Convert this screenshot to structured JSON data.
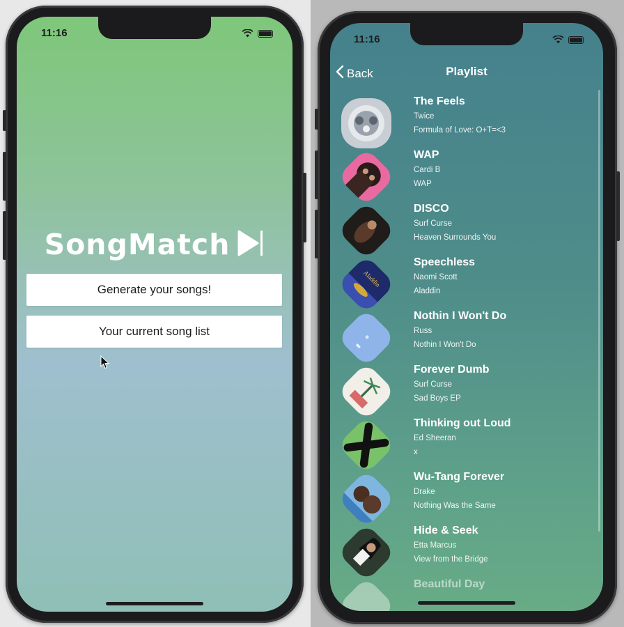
{
  "left_screen": {
    "status_time": "11:16",
    "app_logo_text": "SongMatch",
    "buttons": {
      "generate": "Generate your songs!",
      "song_list": "Your current song list"
    }
  },
  "right_screen": {
    "status_time": "11:16",
    "nav": {
      "back_label": "Back",
      "title": "Playlist"
    },
    "songs": [
      {
        "title": "The Feels",
        "artist": "Twice",
        "album": "Formula of Love: O+T=<3"
      },
      {
        "title": "WAP",
        "artist": "Cardi B",
        "album": "WAP"
      },
      {
        "title": "DISCO",
        "artist": "Surf Curse",
        "album": "Heaven Surrounds You"
      },
      {
        "title": "Speechless",
        "artist": "Naomi Scott",
        "album": "Aladdin"
      },
      {
        "title": "Nothin I Won't Do",
        "artist": "Russ",
        "album": "Nothin I Won't Do"
      },
      {
        "title": "Forever Dumb",
        "artist": "Surf Curse",
        "album": "Sad Boys EP"
      },
      {
        "title": "Thinking out Loud",
        "artist": "Ed Sheeran",
        "album": "x"
      },
      {
        "title": "Wu-Tang Forever",
        "artist": "Drake",
        "album": "Nothing Was the Same"
      },
      {
        "title": "Hide & Seek",
        "artist": "Etta Marcus",
        "album": "View from the Bridge"
      },
      {
        "title": "Beautiful Day",
        "artist": "",
        "album": ""
      }
    ]
  },
  "colors": {
    "left_gradient_top": "#7ec77a",
    "left_gradient_bottom": "#8fbfb6",
    "right_gradient_top": "#45818c",
    "right_gradient_bottom": "#68ab86",
    "button_bg": "#ffffff",
    "text_light": "#ffffff"
  },
  "icons": [
    "wifi-icon",
    "battery-icon",
    "play-logo-icon",
    "chevron-left-icon",
    "mouse-cursor-icon"
  ]
}
